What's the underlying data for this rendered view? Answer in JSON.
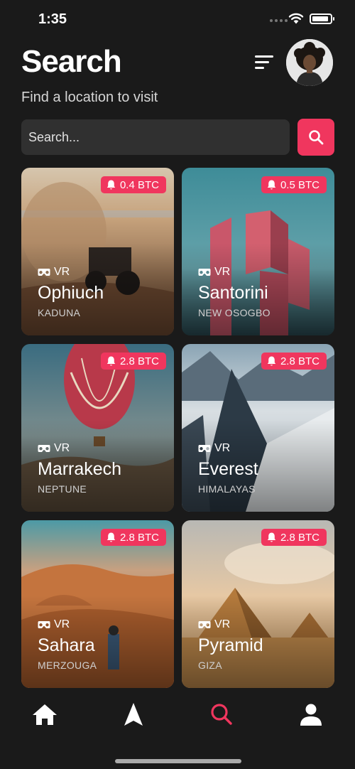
{
  "status_bar": {
    "time": "1:35"
  },
  "header": {
    "title": "Search",
    "subtitle": "Find a location to visit"
  },
  "search": {
    "placeholder": "Search..."
  },
  "colors": {
    "accent": "#f0365e",
    "background": "#1a1a1a",
    "input": "#303030"
  },
  "cards": [
    {
      "price": "0.4 BTC",
      "vr": "VR",
      "name": "Ophiuch",
      "location": "KADUNA"
    },
    {
      "price": "0.5 BTC",
      "vr": "VR",
      "name": "Santorini",
      "location": "NEW OSOGBO"
    },
    {
      "price": "2.8 BTC",
      "vr": "VR",
      "name": "Marrakech",
      "location": "NEPTUNE"
    },
    {
      "price": "2.8 BTC",
      "vr": "VR",
      "name": "Everest",
      "location": "HIMALAYAS"
    },
    {
      "price": "2.8 BTC",
      "vr": "VR",
      "name": "Sahara",
      "location": "MERZOUGA"
    },
    {
      "price": "2.8 BTC",
      "vr": "VR",
      "name": "Pyramid",
      "location": "GIZA"
    }
  ],
  "nav": {
    "items": [
      {
        "icon": "home-icon",
        "active": false
      },
      {
        "icon": "navigate-icon",
        "active": false
      },
      {
        "icon": "search-icon",
        "active": true
      },
      {
        "icon": "profile-icon",
        "active": false
      }
    ]
  }
}
